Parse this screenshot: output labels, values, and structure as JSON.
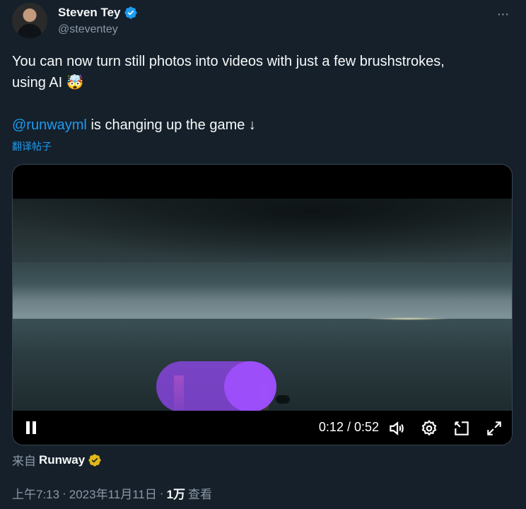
{
  "author": {
    "display_name": "Steven Tey",
    "handle": "@steventey",
    "avatar_icon": "profile-avatar",
    "verified_icon": "verified-badge-icon"
  },
  "tweet": {
    "text_line1": "You can now turn still photos into videos with just a few brushstrokes,",
    "text_line2_prefix": "using AI ",
    "emoji": "🤯",
    "mention": "@runwayml",
    "mention_suffix": " is changing up the game ↓",
    "translate_label": "翻译帖子"
  },
  "video": {
    "timecode": "0:12 / 0:52",
    "progress": 0.23,
    "controls": [
      "pause-icon",
      "volume-icon",
      "settings-icon",
      "pop-out-icon",
      "fullscreen-icon"
    ]
  },
  "source": {
    "prefix": "来自",
    "name": "Runway",
    "badge_icon": "gold-verified-badge-icon"
  },
  "meta": {
    "time": "上午7:13",
    "sep1": "·",
    "date": "2023年11月11日",
    "sep2": "·",
    "views": "1万",
    "views_label": "查看"
  },
  "colors": {
    "background": "#15202b",
    "accent": "#1d9bf0",
    "muted": "#8b98a5"
  }
}
